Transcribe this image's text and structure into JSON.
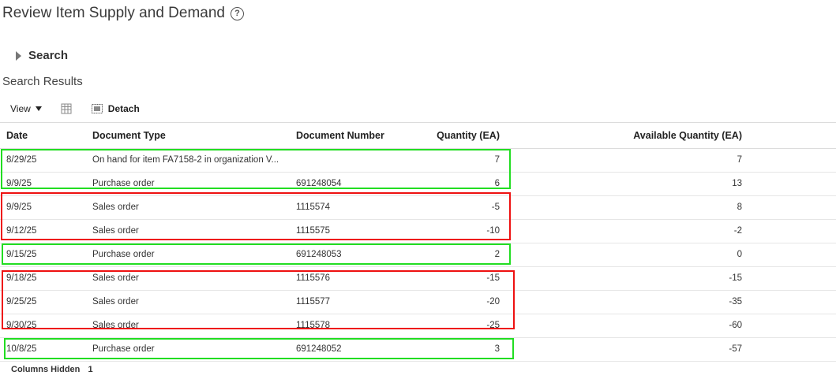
{
  "page": {
    "title": "Review Item Supply and Demand",
    "help_icon": "?"
  },
  "search": {
    "label": "Search"
  },
  "results": {
    "title": "Search Results"
  },
  "toolbar": {
    "view_label": "View",
    "detach_label": "Detach"
  },
  "table": {
    "headers": {
      "date": "Date",
      "type": "Document Type",
      "number": "Document Number",
      "qty": "Quantity (EA)",
      "avail": "Available Quantity (EA)"
    },
    "rows": [
      {
        "date": "8/29/25",
        "type": "On hand for item FA7158-2 in organization V...",
        "number": "",
        "qty": "7",
        "avail": "7"
      },
      {
        "date": "9/9/25",
        "type": "Purchase order",
        "number": "691248054",
        "qty": "6",
        "avail": "13"
      },
      {
        "date": "9/9/25",
        "type": "Sales order",
        "number": "1115574",
        "qty": "-5",
        "avail": "8"
      },
      {
        "date": "9/12/25",
        "type": "Sales order",
        "number": "1115575",
        "qty": "-10",
        "avail": "-2"
      },
      {
        "date": "9/15/25",
        "type": "Purchase order",
        "number": "691248053",
        "qty": "2",
        "avail": "0"
      },
      {
        "date": "9/18/25",
        "type": "Sales order",
        "number": "1115576",
        "qty": "-15",
        "avail": "-15"
      },
      {
        "date": "9/25/25",
        "type": "Sales order",
        "number": "1115577",
        "qty": "-20",
        "avail": "-35"
      },
      {
        "date": "9/30/25",
        "type": "Sales order",
        "number": "1115578",
        "qty": "-25",
        "avail": "-60"
      },
      {
        "date": "10/8/25",
        "type": "Purchase order",
        "number": "691248052",
        "qty": "3",
        "avail": "-57"
      }
    ]
  },
  "footer": {
    "columns_hidden_label": "Columns Hidden",
    "columns_hidden_count": "1"
  },
  "colors": {
    "supply_highlight": "#22dd22",
    "demand_highlight": "#ee1111"
  }
}
